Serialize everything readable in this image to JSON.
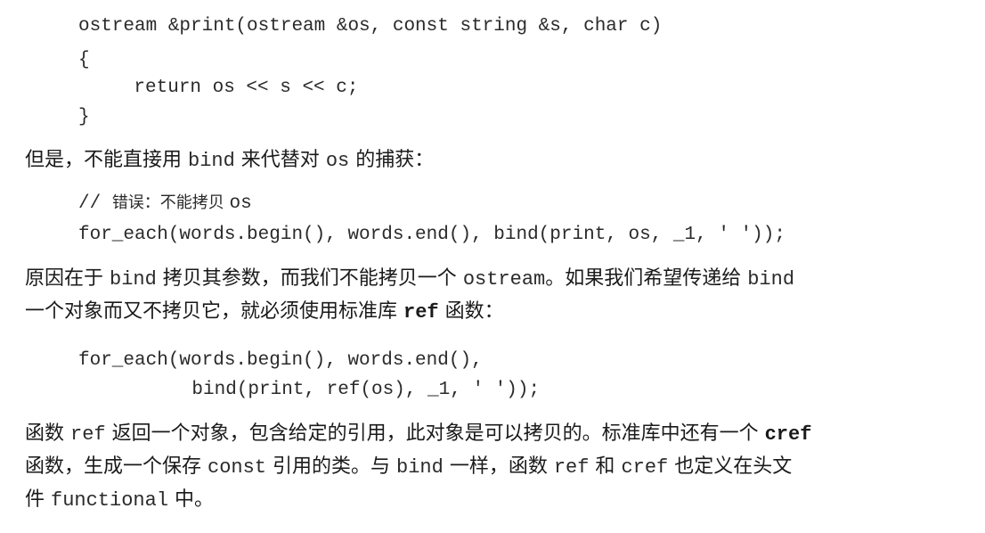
{
  "code_block_1": {
    "line1": "ostream &print(ostream &os, const string &s, char c)",
    "line2": "{",
    "line3": "    return os << s << c;",
    "line4": "}"
  },
  "para1": {
    "t1": "但是，不能直接用 ",
    "c1": "bind",
    "t2": " 来代替对 ",
    "c2": "os",
    "t3": " 的捕获："
  },
  "code_block_2": {
    "comment_prefix": "// ",
    "comment_text": "错误：不能拷贝 ",
    "comment_code": "os",
    "line2": "for_each(words.begin(), words.end(), bind(print, os, _1, ' '));"
  },
  "para2": {
    "t1": "原因在于 ",
    "c1": "bind",
    "t2": " 拷贝其参数，而我们不能拷贝一个 ",
    "c2": "ostream",
    "t3": "。如果我们希望传递给 ",
    "c3": "bind",
    "t4": "一个对象而又不拷贝它，就必须使用标准库 ",
    "c4": "ref",
    "t5": " 函数："
  },
  "code_block_3": {
    "line1": "for_each(words.begin(), words.end(),",
    "line2": "         bind(print, ref(os), _1, ' '));"
  },
  "para3": {
    "t1": "函数 ",
    "c1": "ref",
    "t2": " 返回一个对象，包含给定的引用，此对象是可以拷贝的。标准库中还有一个 ",
    "c2": "cref",
    "t3": "函数，生成一个保存 ",
    "c3": "const",
    "t4": " 引用的类。与 ",
    "c4": "bind",
    "t5": " 一样，函数 ",
    "c5": "ref",
    "t6": " 和 ",
    "c6": "cref",
    "t7": " 也定义在头文",
    "t8": "件 ",
    "c7": "functional",
    "t9": " 中。"
  }
}
